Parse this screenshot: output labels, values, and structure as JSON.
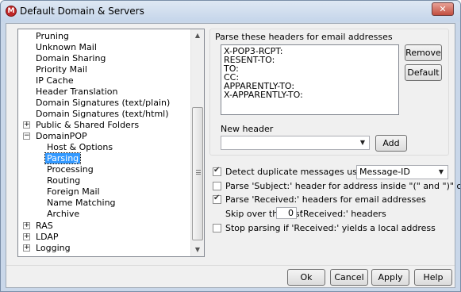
{
  "window": {
    "title": "Default Domain & Servers",
    "app_icon": "M",
    "close_label": "✕"
  },
  "tree": {
    "items": [
      {
        "label": "Pruning"
      },
      {
        "label": "Unknown Mail"
      },
      {
        "label": "Domain Sharing"
      },
      {
        "label": "Priority Mail"
      },
      {
        "label": "IP Cache"
      },
      {
        "label": "Header Translation"
      },
      {
        "label": "Domain Signatures (text/plain)"
      },
      {
        "label": "Domain Signatures (text/html)"
      },
      {
        "label": "Public & Shared Folders",
        "expander": "+"
      },
      {
        "label": "DomainPOP",
        "expander": "−"
      },
      {
        "label": "Host & Options"
      },
      {
        "label": "Parsing",
        "selected": true
      },
      {
        "label": "Processing"
      },
      {
        "label": "Routing"
      },
      {
        "label": "Foreign Mail"
      },
      {
        "label": "Name Matching"
      },
      {
        "label": "Archive"
      },
      {
        "label": "RAS",
        "expander": "+"
      },
      {
        "label": "LDAP",
        "expander": "+"
      },
      {
        "label": "Logging",
        "expander": "+"
      }
    ]
  },
  "parse_group": {
    "label": "Parse these headers for email addresses",
    "headers": [
      "X-POP3-RCPT:",
      "RESENT-TO:",
      "TO:",
      "CC:",
      "APPARENTLY-TO:",
      "X-APPARENTLY-TO:"
    ],
    "remove_label": "Remove",
    "default_label": "Default",
    "new_header_label": "New header",
    "new_header_value": "",
    "add_label": "Add"
  },
  "options": {
    "detect_duplicate": {
      "label": "Detect duplicate messages using this header",
      "checked": true,
      "header_value": "Message-ID"
    },
    "parse_subject": {
      "label": "Parse 'Subject:' header for address inside \"(\" and \")\" characters",
      "checked": false
    },
    "parse_received": {
      "label": "Parse 'Received:' headers for email addresses",
      "checked": true
    },
    "skip_prefix": "Skip over the first",
    "skip_value": "0",
    "skip_suffix": "'Received:' headers",
    "stop_parsing": {
      "label": "Stop parsing if 'Received:' yields a local address",
      "checked": false
    }
  },
  "buttons": {
    "ok": "Ok",
    "cancel": "Cancel",
    "apply": "Apply",
    "help": "Help"
  }
}
